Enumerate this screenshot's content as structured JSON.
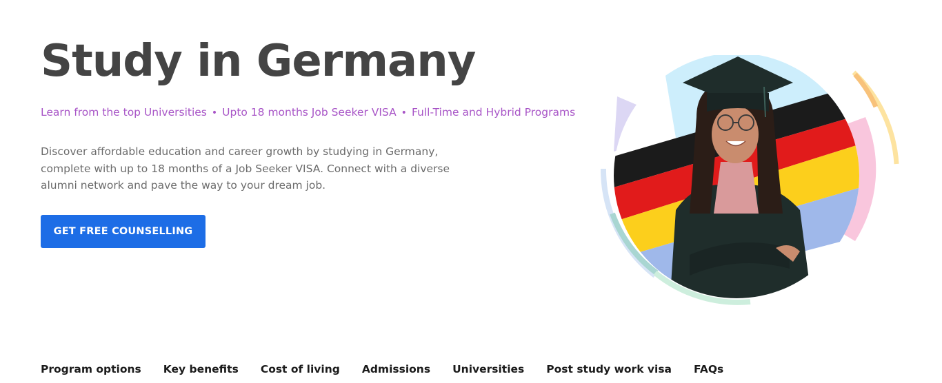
{
  "hero": {
    "title": "Study in Germany",
    "highlights": [
      "Learn from the top Universities",
      "Upto 18 months Job Seeker VISA",
      "Full-Time and Hybrid Programs"
    ],
    "description": "Discover affordable education and career growth by studying in Germany, complete with up to 18 months of a Job Seeker VISA. Connect with a diverse alumni network and pave the way to your dream job.",
    "cta_label": "GET FREE COUNSELLING",
    "image": "graduate-student-german-flag-photo"
  },
  "colors": {
    "title": "#444444",
    "highlight": "#a855c7",
    "cta_background": "#1d6de6",
    "nav_text": "#1b1b1b"
  },
  "section_nav": {
    "items": [
      "Program options",
      "Key benefits",
      "Cost of living",
      "Admissions",
      "Universities",
      "Post study work visa",
      "FAQs"
    ]
  }
}
